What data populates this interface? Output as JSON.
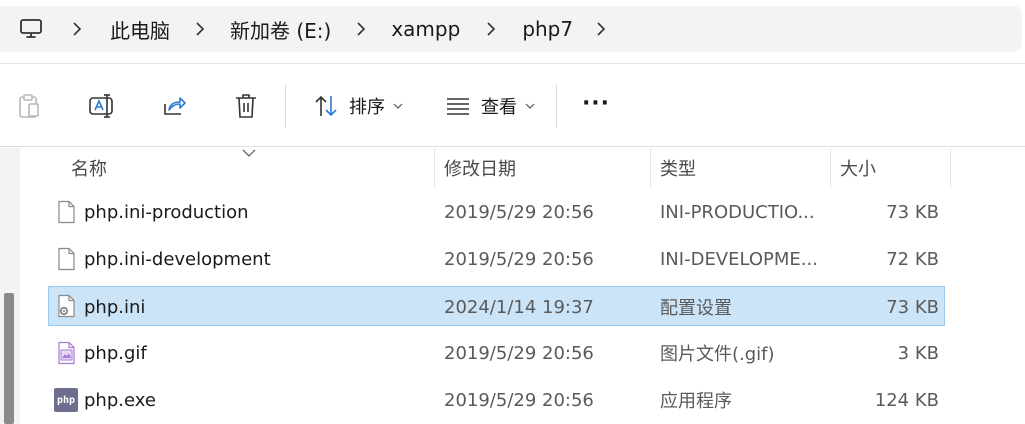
{
  "breadcrumb": {
    "items": [
      "此电脑",
      "新加卷 (E:)",
      "xampp",
      "php7"
    ]
  },
  "toolbar": {
    "sort_label": "排序",
    "view_label": "查看",
    "more_label": "···"
  },
  "columns": {
    "name": "名称",
    "date": "修改日期",
    "type": "类型",
    "size": "大小"
  },
  "files": [
    {
      "name": "php.ini-production",
      "date": "2019/5/29 20:56",
      "type": "INI-PRODUCTIO...",
      "size": "73 KB",
      "icon": "generic-file-icon",
      "selected": false
    },
    {
      "name": "php.ini-development",
      "date": "2019/5/29 20:56",
      "type": "INI-DEVELOPME...",
      "size": "72 KB",
      "icon": "generic-file-icon",
      "selected": false
    },
    {
      "name": "php.ini",
      "date": "2024/1/14 19:37",
      "type": "配置设置",
      "size": "73 KB",
      "icon": "config-file-icon",
      "selected": true
    },
    {
      "name": "php.gif",
      "date": "2019/5/29 20:56",
      "type": "图片文件(.gif)",
      "size": "3 KB",
      "icon": "image-file-icon",
      "selected": false
    },
    {
      "name": "php.exe",
      "date": "2019/5/29 20:56",
      "type": "应用程序",
      "size": "124 KB",
      "icon": "php-exe-icon",
      "selected": false
    }
  ],
  "exe_icon_text": "php",
  "colors": {
    "selection_bg": "#cce4f7",
    "selection_border": "#99c9ef",
    "address_bg": "#f3f3f3",
    "accent_blue": "#2b7bd6",
    "gif_purple": "#a77bd1"
  }
}
